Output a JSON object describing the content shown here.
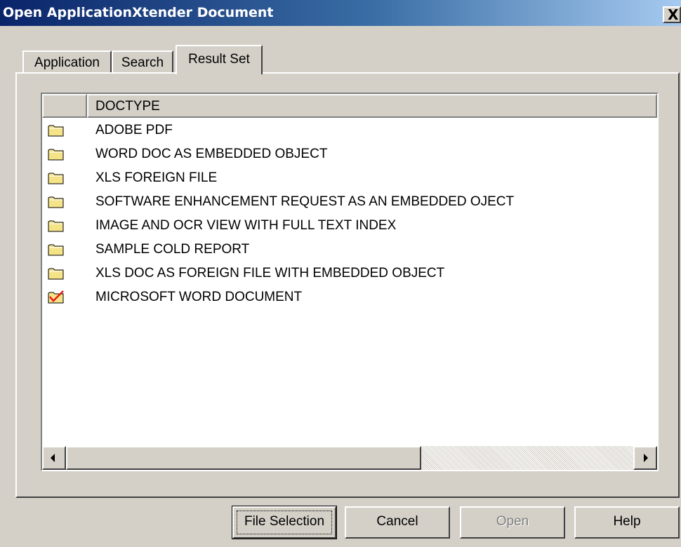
{
  "window": {
    "title": "Open ApplicationXtender Document",
    "close_glyph": "X"
  },
  "tabs": [
    {
      "label": "Application",
      "selected": false
    },
    {
      "label": "Search",
      "selected": false
    },
    {
      "label": "Result Set",
      "selected": true
    }
  ],
  "list": {
    "column_header": "DOCTYPE",
    "rows": [
      {
        "label": "ADOBE PDF",
        "icon": "folder-icon"
      },
      {
        "label": "WORD DOC AS EMBEDDED OBJECT",
        "icon": "folder-icon"
      },
      {
        "label": "XLS FOREIGN FILE",
        "icon": "folder-icon"
      },
      {
        "label": "SOFTWARE ENHANCEMENT REQUEST AS AN EMBEDDED OJECT",
        "icon": "folder-icon"
      },
      {
        "label": "IMAGE AND OCR VIEW WITH FULL TEXT INDEX",
        "icon": "folder-icon"
      },
      {
        "label": "SAMPLE COLD REPORT",
        "icon": "folder-icon"
      },
      {
        "label": "XLS DOC AS FOREIGN FILE WITH EMBEDDED OBJECT",
        "icon": "folder-icon"
      },
      {
        "label": "MICROSOFT WORD DOCUMENT",
        "icon": "checked-folder-icon"
      }
    ]
  },
  "buttons": {
    "file_selection": "File Selection",
    "cancel": "Cancel",
    "open": "Open",
    "help": "Help"
  },
  "colors": {
    "titlebar_start": "#0a246a",
    "titlebar_end": "#a6caf0",
    "folder": "#f5e388",
    "check": "#e81818"
  }
}
